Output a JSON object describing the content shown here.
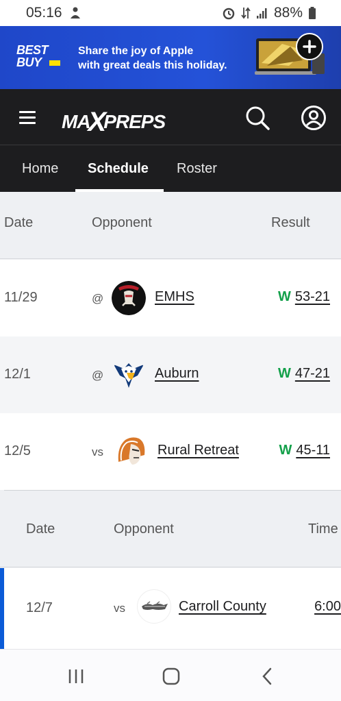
{
  "status_bar": {
    "time": "05:16",
    "battery": "88%"
  },
  "ad": {
    "brand_line1": "BEST",
    "brand_line2": "BUY",
    "text_line1": "Share the joy of Apple",
    "text_line2": "with great deals this holiday."
  },
  "header": {
    "brand_pre": "MA",
    "brand_x": "X",
    "brand_post": "PREPS"
  },
  "tabs": [
    {
      "label": "Home"
    },
    {
      "label": "Schedule"
    },
    {
      "label": "Roster"
    }
  ],
  "results_table": {
    "columns": {
      "date": "Date",
      "opponent": "Opponent",
      "result": "Result"
    },
    "rows": [
      {
        "date": "11/29",
        "home_away": "@",
        "opponent": "EMHS",
        "wl": "W",
        "score": "53-21"
      },
      {
        "date": "12/1",
        "home_away": "@",
        "opponent": "Auburn",
        "wl": "W",
        "score": "47-21"
      },
      {
        "date": "12/5",
        "home_away": "vs",
        "opponent": "Rural Retreat",
        "wl": "W",
        "score": "45-11"
      }
    ]
  },
  "upcoming_table": {
    "columns": {
      "date": "Date",
      "opponent": "Opponent",
      "time": "Time"
    },
    "rows": [
      {
        "date": "12/7",
        "home_away": "vs",
        "opponent": "Carroll County",
        "time": "6:00"
      }
    ]
  },
  "colors": {
    "accent_blue": "#0b5bd7",
    "win_green": "#13a04a",
    "header_dark": "#1d1d1f",
    "ad_blue": "#2452d8"
  }
}
